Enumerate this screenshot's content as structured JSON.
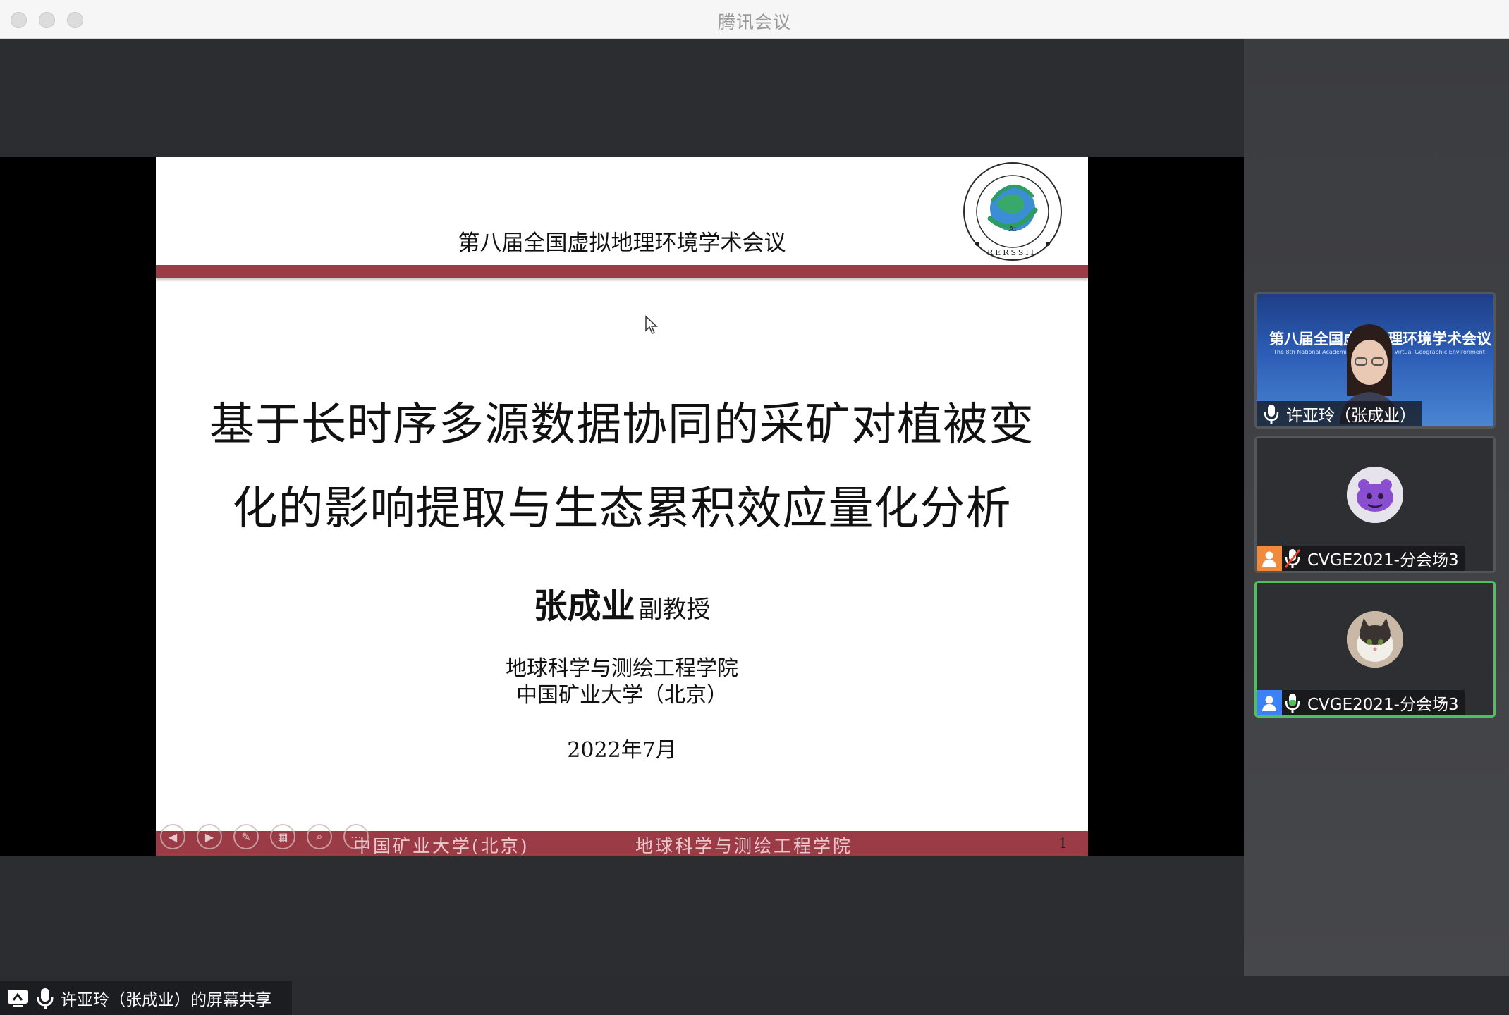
{
  "window": {
    "title": "腾讯会议"
  },
  "slide": {
    "conference": "第八届全国虚拟地理环境学术会议",
    "title_line1": "基于长时序多源数据协同的采矿对植被变",
    "title_line2": "化的影响提取与生态累积效应量化分析",
    "author_name": "张成业",
    "author_role": "副教授",
    "affiliation_1": "地球科学与测绘工程学院",
    "affiliation_2": "中国矿业大学（北京）",
    "date": "2022年7月",
    "footer_left": "中国矿业大学(北京)",
    "footer_right": "地球科学与测绘工程学院",
    "page_number": "1",
    "brand_color": "#9b3b46"
  },
  "share_label": {
    "text": "许亚玲（张成业）的屏幕共享",
    "icons": [
      "screen-share-icon",
      "mic-icon"
    ]
  },
  "participants": [
    {
      "name": "许亚玲（张成业）",
      "type": "video",
      "mic": "on",
      "active": false,
      "video_title": "第八届全国虚拟地理环境学术会议",
      "video_sub": "The 8th National Academic Conference on Virtual Geographic Environment"
    },
    {
      "name": "CVGE2021-分会场3",
      "type": "avatar",
      "mic": "muted",
      "badge_color": "#f08a3c",
      "active": false
    },
    {
      "name": "CVGE2021-分会场3",
      "type": "avatar",
      "mic": "on",
      "badge_color": "#3b82f6",
      "active": true
    }
  ],
  "colors": {
    "active_speaker": "#4cc25d"
  }
}
